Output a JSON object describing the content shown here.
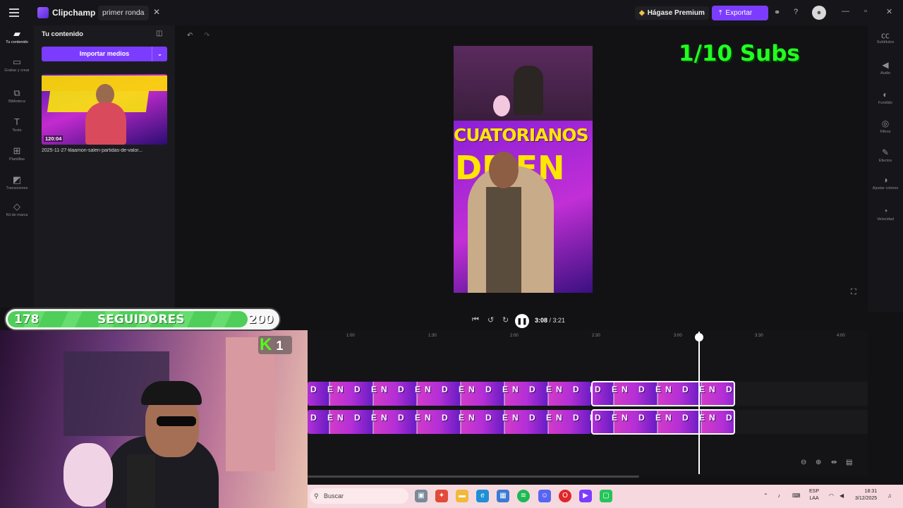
{
  "app": {
    "name": "Clipchamp",
    "project_name": "primer ronda",
    "premium_label": "Hágase Premium",
    "export_label": "Exportar",
    "colors": {
      "accent": "#7c3cff",
      "subs_green": "#22ff22",
      "follower_green": "#4fcf5a"
    }
  },
  "left_rail": [
    {
      "label": "Tu contenido",
      "icon": "folder-icon"
    },
    {
      "label": "Grabar y crear",
      "icon": "camera-icon"
    },
    {
      "label": "Biblioteca",
      "icon": "library-icon"
    },
    {
      "label": "Texto",
      "icon": "text-icon"
    },
    {
      "label": "Plantillas",
      "icon": "templates-icon"
    },
    {
      "label": "Transiciones",
      "icon": "transitions-icon"
    },
    {
      "label": "Kit de marca",
      "icon": "brand-kit-icon"
    }
  ],
  "panel": {
    "title": "Tu contenido",
    "import_label": "Importar medios",
    "media": {
      "duration": "120:04",
      "filename": "2025-11-27-lilaamon-salen-partidas-de-valor..."
    }
  },
  "preview": {
    "video_banner_top": "CUATORIANOS",
    "video_banner_big": "DE EN",
    "subs_counter": "1/10 Subs"
  },
  "right_rail": [
    {
      "label": "Subtítulos",
      "icon": "captions-icon"
    },
    {
      "label": "Audio",
      "icon": "speaker-icon"
    },
    {
      "label": "Fundido",
      "icon": "fade-icon"
    },
    {
      "label": "Filtros",
      "icon": "filters-icon"
    },
    {
      "label": "Efectos",
      "icon": "effects-icon"
    },
    {
      "label": "Ajustar colores",
      "icon": "adjust-colors-icon"
    },
    {
      "label": "Velocidad",
      "icon": "speed-icon"
    }
  ],
  "transport": {
    "current": "3:08",
    "total": "/ 3:21"
  },
  "timeline": {
    "ticks": [
      "1:00",
      "1:30",
      "2:00",
      "2:30",
      "3:00",
      "3:30",
      "4:00"
    ],
    "clip_label": "D EN D EN D EN D EN D EN D EN D EN"
  },
  "overlay": {
    "followers_current": "178",
    "followers_label": "SEGUIDORES",
    "followers_goal": "200",
    "followers_progress": 0.89,
    "kick_count": "1"
  },
  "taskbar": {
    "search_placeholder": "Buscar",
    "lang_top": "ESP",
    "lang_bottom": "LAA",
    "time": "18:31",
    "date": "3/12/2025"
  }
}
